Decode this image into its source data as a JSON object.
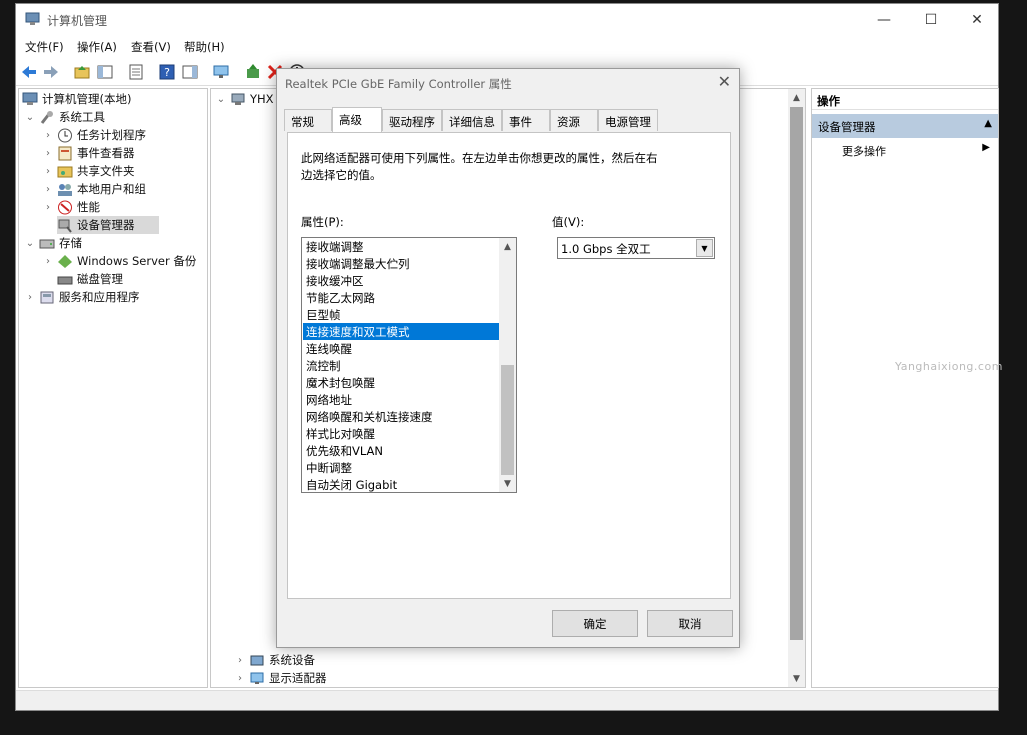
{
  "window": {
    "title": "计算机管理",
    "minimize": "—",
    "maximize": "☐",
    "close": "✕"
  },
  "menu": [
    "文件(F)",
    "操作(A)",
    "查看(V)",
    "帮助(H)"
  ],
  "tree": {
    "root": "计算机管理(本地)",
    "system_tools": "系统工具",
    "task_scheduler": "任务计划程序",
    "event_viewer": "事件查看器",
    "shared_folders": "共享文件夹",
    "local_users": "本地用户和组",
    "performance": "性能",
    "device_manager": "设备管理器",
    "storage": "存储",
    "windows_server_backup": "Windows Server 备份",
    "disk_management": "磁盘管理",
    "services_apps": "服务和应用程序"
  },
  "devices": {
    "root": "YHX",
    "system_devices": "系统设备",
    "display_adapters": "显示适配器"
  },
  "actions": {
    "header": "操作",
    "section": "设备管理器",
    "more": "更多操作"
  },
  "dialog": {
    "title": "Realtek PCIe GbE Family Controller 属性",
    "close": "✕",
    "tabs": [
      "常规",
      "高级",
      "驱动程序",
      "详细信息",
      "事件",
      "资源",
      "电源管理"
    ],
    "active_tab": "高级",
    "description_line1": "此网络适配器可使用下列属性。在左边单击你想更改的属性，然后在右",
    "description_line2": "边选择它的值。",
    "property_label": "属性(P):",
    "value_label": "值(V):",
    "properties": [
      "接收端调整",
      "接收端调整最大伫列",
      "接收缓冲区",
      "节能乙太网路",
      "巨型帧",
      "连接速度和双工模式",
      "连线唤醒",
      "流控制",
      "魔术封包唤醒",
      "网络地址",
      "网络唤醒和关机连接速度",
      "样式比对唤醒",
      "优先级和VLAN",
      "中断调整",
      "自动关闭 Gigabit"
    ],
    "selected_property": "连接速度和双工模式",
    "selected_value": "1.0 Gbps 全双工",
    "ok": "确定",
    "cancel": "取消"
  },
  "watermark": "Yanghaixiong.com",
  "colors": {
    "selection": "#0078d7",
    "action_header": "#b8cbdf"
  }
}
